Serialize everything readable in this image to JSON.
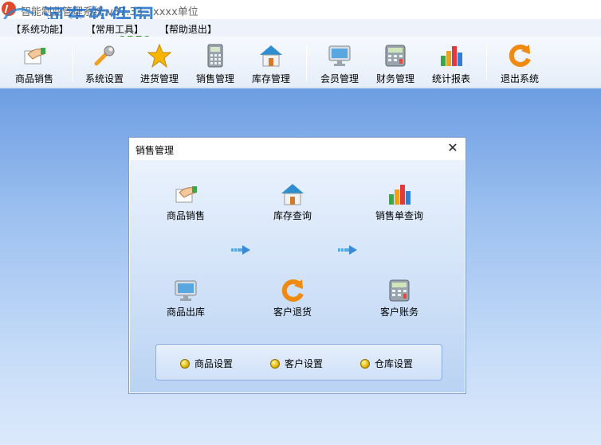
{
  "window": {
    "title": "智能制业管理系统 v37.33 - xxxx单位",
    "watermark_text": "河东软件园",
    "watermark_url": "www.pc0359.cn"
  },
  "menu": [
    {
      "label": "【系统功能】"
    },
    {
      "label": "【常用工具】"
    },
    {
      "label": "【帮助退出】"
    }
  ],
  "toolbar": [
    {
      "label": "商品销售",
      "icon": "hand-card-icon"
    },
    {
      "label": "系统设置",
      "icon": "wrench-icon"
    },
    {
      "label": "进货管理",
      "icon": "star-icon"
    },
    {
      "label": "销售管理",
      "icon": "calculator-icon"
    },
    {
      "label": "库存管理",
      "icon": "house-icon"
    },
    {
      "label": "会员管理",
      "icon": "monitor-icon"
    },
    {
      "label": "财务管理",
      "icon": "cash-register-icon"
    },
    {
      "label": "统计报表",
      "icon": "bar-chart-icon"
    },
    {
      "label": "退出系统",
      "icon": "refresh-icon"
    }
  ],
  "dialog": {
    "title": "销售管理",
    "close_label": "✕",
    "functions": [
      {
        "label": "商品销售",
        "icon": "hand-card-icon"
      },
      {
        "label": "库存查询",
        "icon": "house-icon"
      },
      {
        "label": "销售单查询",
        "icon": "bar-chart-icon"
      },
      {
        "label": "商品出库",
        "icon": "monitor-icon"
      },
      {
        "label": "客户退货",
        "icon": "refresh-icon"
      },
      {
        "label": "客户账务",
        "icon": "cash-register-icon"
      }
    ],
    "settings": [
      {
        "label": "商品设置"
      },
      {
        "label": "客户设置"
      },
      {
        "label": "仓库设置"
      }
    ]
  },
  "colors": {
    "desktop_top": "#6d9de2",
    "desktop_bottom": "#dce9fb",
    "accent": "#2d86d6"
  }
}
